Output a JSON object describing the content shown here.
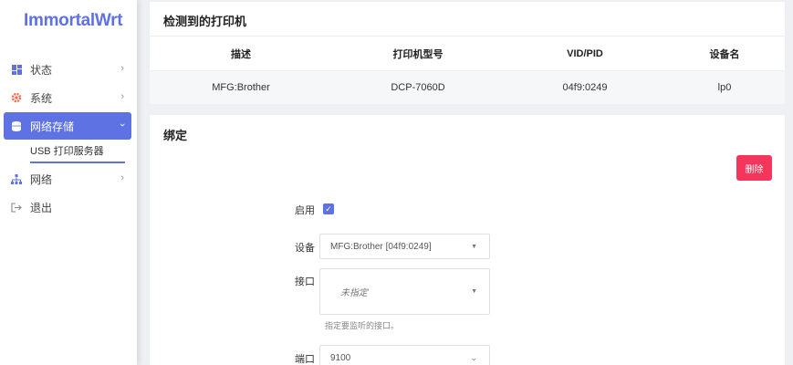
{
  "sidebar": {
    "logo": "ImmortalWrt",
    "items": [
      {
        "label": "状态",
        "icon": "dashboard-icon"
      },
      {
        "label": "系统",
        "icon": "gear-icon"
      },
      {
        "label": "网络存储",
        "icon": "storage-icon"
      },
      {
        "label": "网络",
        "icon": "network-icon"
      },
      {
        "label": "退出",
        "icon": "logout-icon"
      }
    ],
    "sub_items": [
      {
        "label": "USB 打印服务器"
      }
    ]
  },
  "printers": {
    "title": "检测到的打印机",
    "columns": [
      "描述",
      "打印机型号",
      "VID/PID",
      "设备名"
    ],
    "rows": [
      [
        "MFG:Brother",
        "DCP-7060D",
        "04f9:0249",
        "lp0"
      ]
    ]
  },
  "binding": {
    "title": "绑定",
    "delete_label": "删除",
    "enable_label": "启用",
    "enabled": true,
    "device_label": "设备",
    "device_value": "MFG:Brother [04f9:0249]",
    "interface_label": "接口",
    "interface_value": "未指定",
    "interface_help": "指定要监听的接口。",
    "port_label": "端口",
    "port_value": "9100"
  },
  "colors": {
    "accent": "#5e72e4",
    "danger": "#f5365c"
  }
}
